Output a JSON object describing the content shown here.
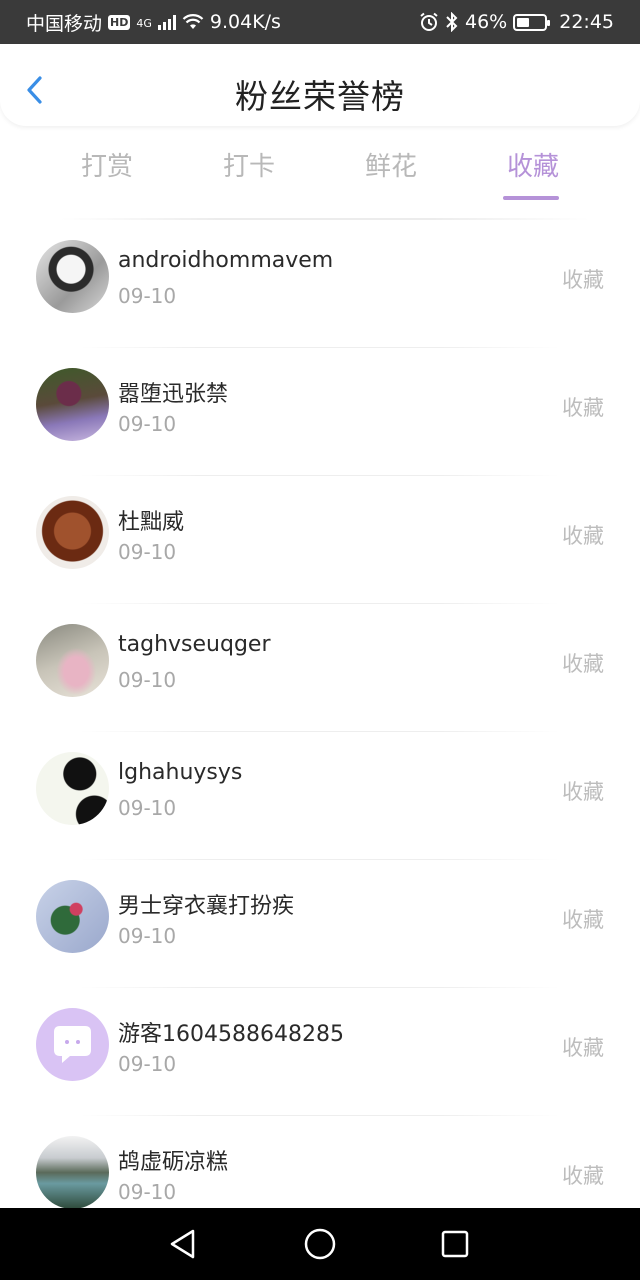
{
  "status_bar": {
    "carrier": "中国移动",
    "hd": "HD",
    "network": "4G",
    "speed": "9.04K/s",
    "battery": "46%",
    "time": "22:45"
  },
  "header": {
    "title": "粉丝荣誉榜",
    "back_icon": "chevron-left-icon",
    "accent_color": "#3a8ee6"
  },
  "tabs": [
    {
      "label": "打赏",
      "active": false
    },
    {
      "label": "打卡",
      "active": false
    },
    {
      "label": "鲜花",
      "active": false
    },
    {
      "label": "收藏",
      "active": true
    }
  ],
  "accent_color": "#b592d8",
  "list": [
    {
      "name": "androidhommavem",
      "date": "09-10",
      "action": "收藏",
      "avatar": "avatar-photo"
    },
    {
      "name": "嚣堕迅张禁",
      "date": "09-10",
      "action": "收藏",
      "avatar": "avatar-photo"
    },
    {
      "name": "杜黜威",
      "date": "09-10",
      "action": "收藏",
      "avatar": "avatar-photo"
    },
    {
      "name": "taghvseuqger",
      "date": "09-10",
      "action": "收藏",
      "avatar": "avatar-photo"
    },
    {
      "name": "lghahuysys",
      "date": "09-10",
      "action": "收藏",
      "avatar": "avatar-photo"
    },
    {
      "name": "男士穿衣襄打扮疾",
      "date": "09-10",
      "action": "收藏",
      "avatar": "avatar-photo"
    },
    {
      "name": "游客1604588648285",
      "date": "09-10",
      "action": "收藏",
      "avatar": "default-chat-avatar"
    },
    {
      "name": "鸪虚砺凉糕",
      "date": "09-10",
      "action": "收藏",
      "avatar": "avatar-photo"
    }
  ],
  "nav_bar": {
    "back": "triangle-back-icon",
    "home": "circle-home-icon",
    "recents": "square-recents-icon"
  }
}
